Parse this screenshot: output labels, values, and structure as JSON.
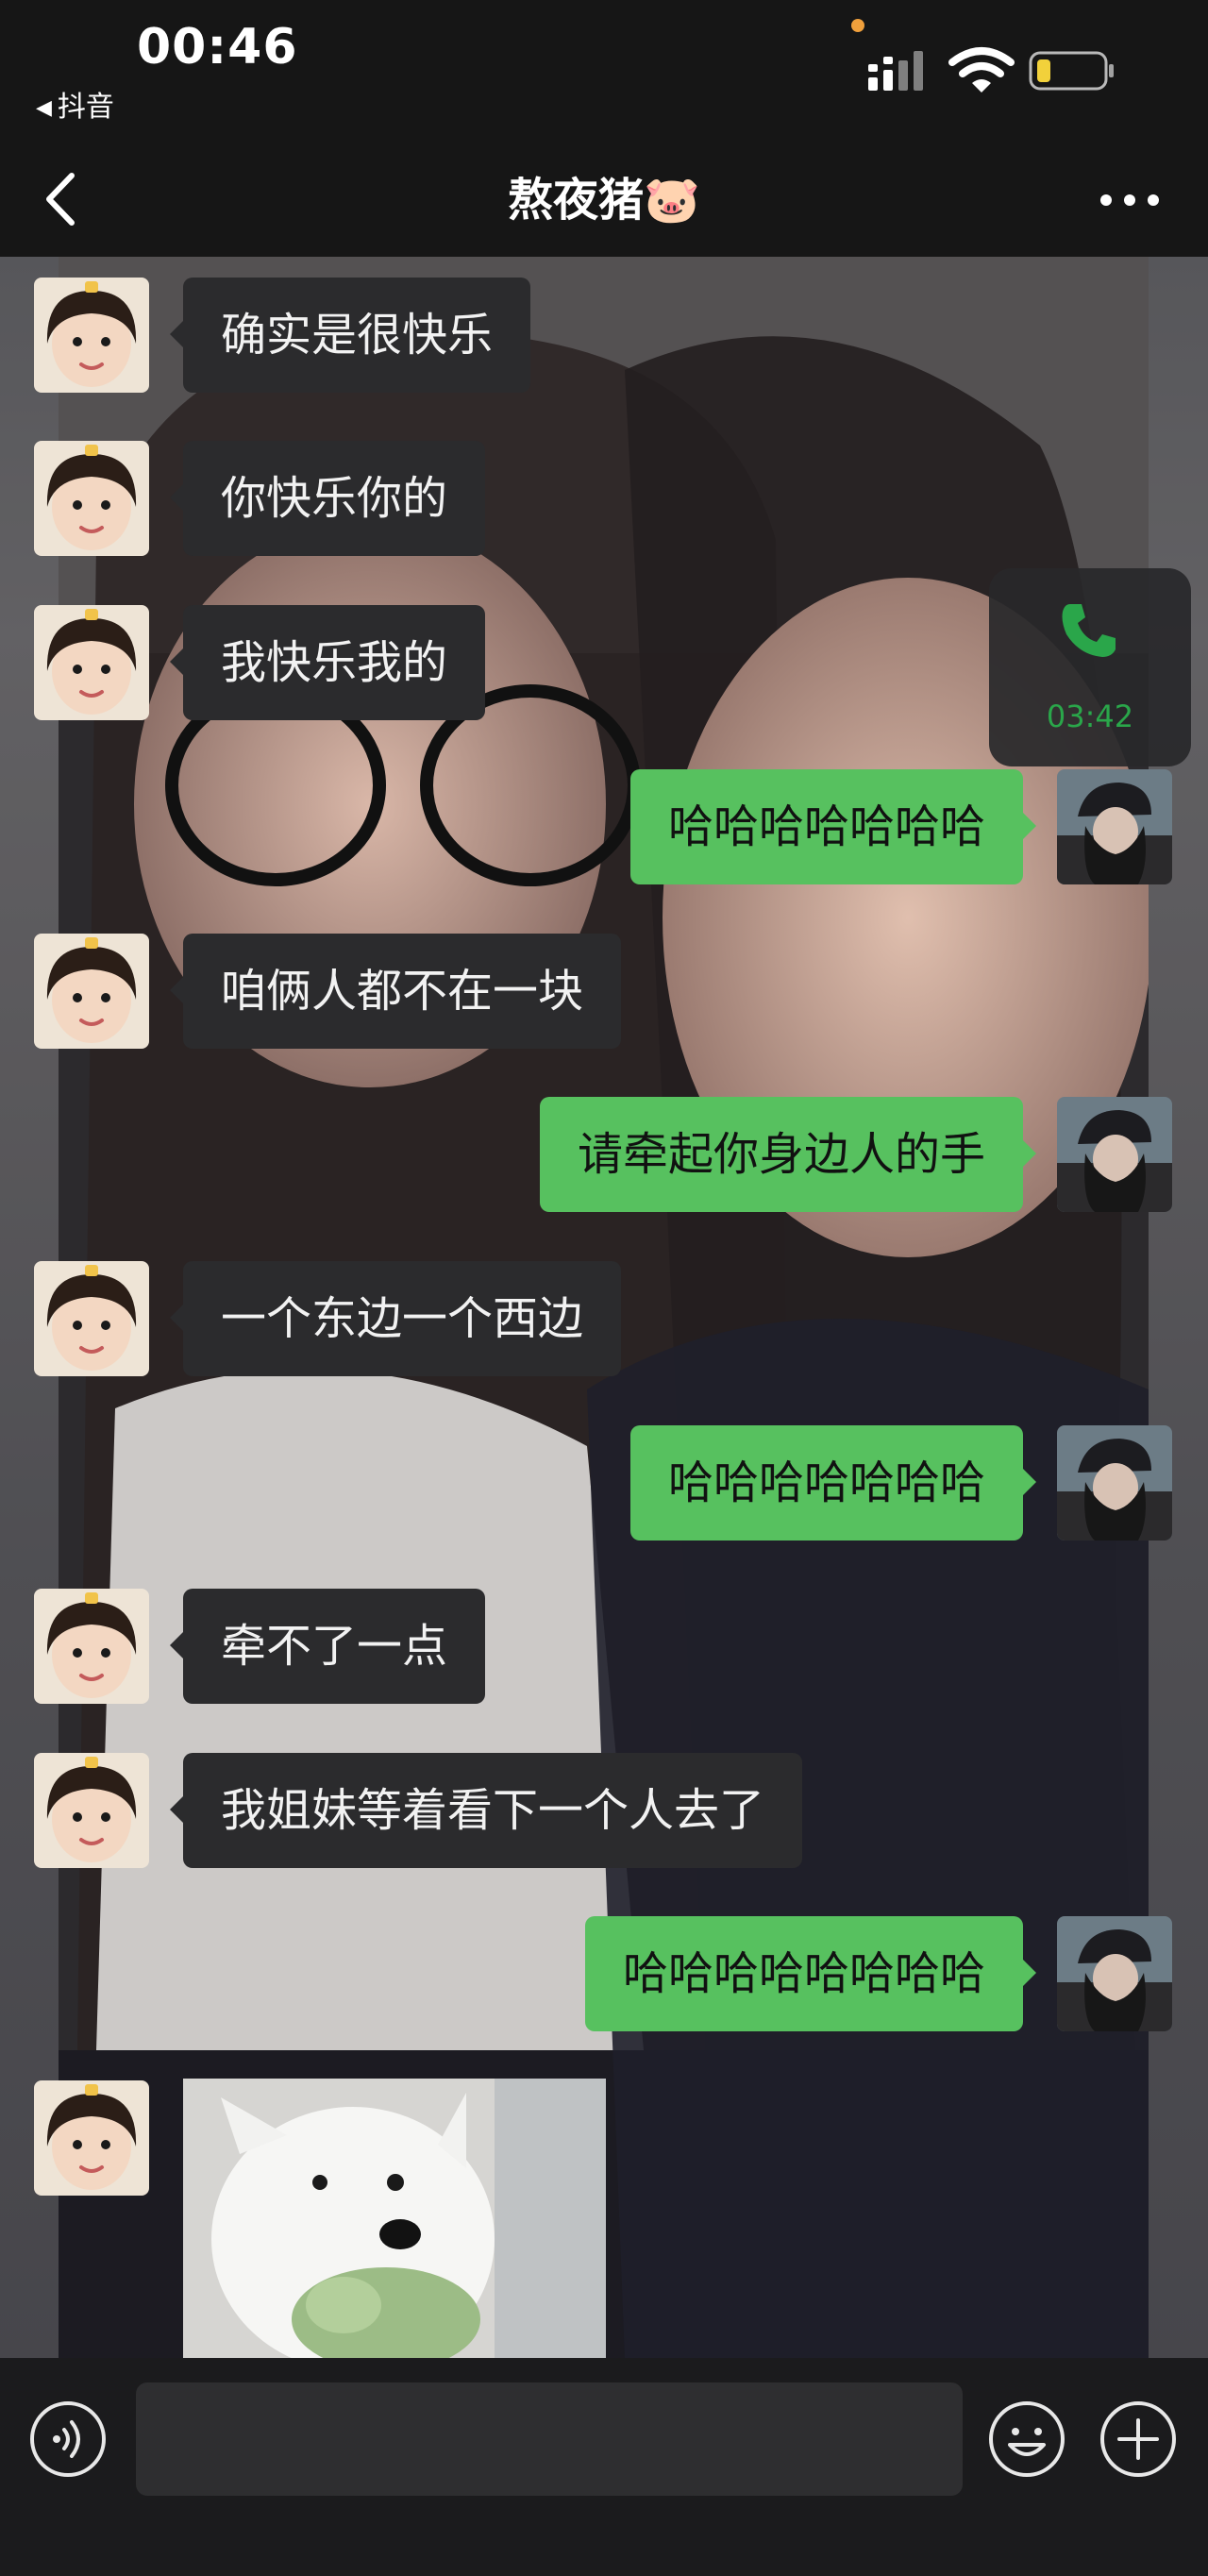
{
  "status_bar": {
    "time": "00:46",
    "back_app": "抖音"
  },
  "nav": {
    "title": "熬夜猪🐷"
  },
  "messages": [
    {
      "side": "left",
      "text": "确实是很快乐"
    },
    {
      "side": "left",
      "text": "你快乐你的"
    },
    {
      "side": "left",
      "text": "我快乐我的"
    },
    {
      "side": "right",
      "text": "哈哈哈哈哈哈哈"
    },
    {
      "side": "left",
      "text": "咱俩人都不在一块"
    },
    {
      "side": "right",
      "text": "请牵起你身边人的手"
    },
    {
      "side": "left",
      "text": "一个东边一个西边"
    },
    {
      "side": "right",
      "text": "哈哈哈哈哈哈哈"
    },
    {
      "side": "left",
      "text": "牵不了一点"
    },
    {
      "side": "left",
      "text": "我姐妹等着看下一个人去了"
    },
    {
      "side": "right",
      "text": "哈哈哈哈哈哈哈哈"
    }
  ],
  "image_message": {
    "side": "left",
    "content": "white-puppy-photo"
  },
  "call_float": {
    "icon": "phone-icon",
    "timer": "03:42"
  },
  "input_bar": {
    "voice_icon": "voice-icon",
    "emoji_icon": "emoji-icon",
    "plus_icon": "plus-icon"
  },
  "colors": {
    "bubble_left": "#2b2b2d",
    "bubble_right": "#57c15f",
    "bar_bg": "#161616",
    "call_green": "#2aa64a"
  }
}
